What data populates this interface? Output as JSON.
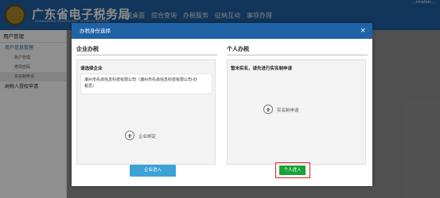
{
  "header": {
    "logo_title": "广东省电子税务局",
    "logo_subtitle": "GUANGDONG ELECTRONIC TAXATION BUREAU",
    "nav": [
      "办税桌面",
      "综合查询",
      "办税服务",
      "征纳互动",
      "事项办理"
    ],
    "top_right": "...rmation..."
  },
  "sidebar": {
    "title": "用户管理",
    "group1": "用户信息管理",
    "items": [
      "账户管理",
      "修改密码",
      "实名制申请"
    ],
    "group2": "纳税人授权申请"
  },
  "modal": {
    "title": "办税身份选择",
    "close": "×",
    "enterprise": {
      "heading": "企业办税",
      "label": "请选择企业",
      "company_line1": "潮州市先卓信息科技有限公司（潮州市先卓信息科技有限公司-办",
      "company_line2": "税员）",
      "bind_label": "企业绑定",
      "enter_button": "企业进入"
    },
    "personal": {
      "heading": "个人办税",
      "notice": "暂未实名，请先进行实名制申请",
      "apply_label": "实名制申请",
      "enter_button": "个人进入"
    }
  }
}
